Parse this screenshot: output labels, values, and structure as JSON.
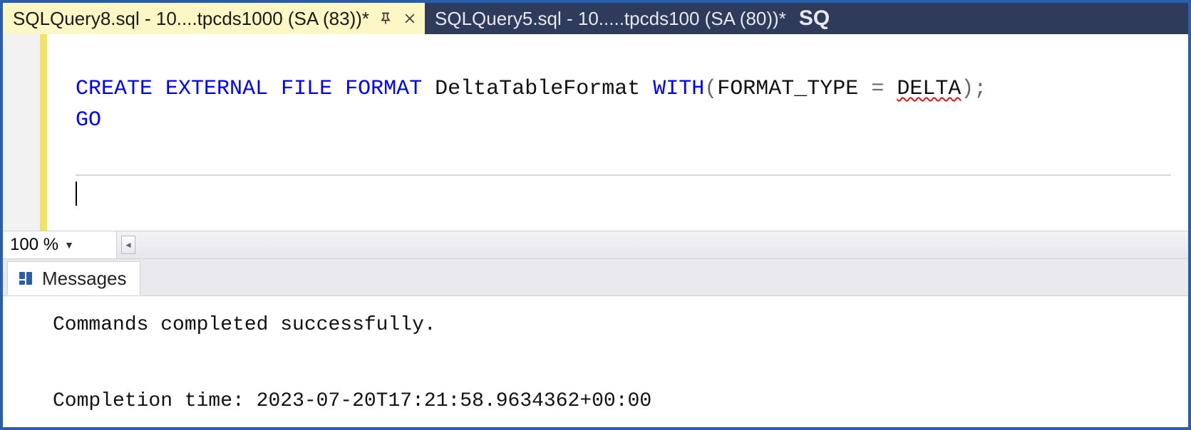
{
  "tabs": {
    "active": {
      "label": "SQLQuery8.sql - 10....tpcds1000 (SA (83))*"
    },
    "inactive": {
      "label": "SQLQuery5.sql - 10.....tpcds100 (SA (80))*"
    },
    "overflow_hint": "SQ"
  },
  "editor": {
    "code_tokens": {
      "kw_create": "CREATE",
      "kw_external": "EXTERNAL",
      "kw_file": "FILE",
      "kw_format": "FORMAT",
      "ident_name": "DeltaTableFormat",
      "kw_with": "WITH",
      "lparen": "(",
      "ident_ft": "FORMAT_TYPE",
      "eq": " = ",
      "ident_delta": "DELTA",
      "rparen_semi": ");",
      "kw_go": "GO"
    }
  },
  "zoom": {
    "value": "100 %"
  },
  "results": {
    "tab_label": "Messages",
    "line1": "Commands completed successfully.",
    "line2_prefix": "Completion time: ",
    "line2_time": "2023-07-20T17:21:58.9634362+00:00"
  }
}
